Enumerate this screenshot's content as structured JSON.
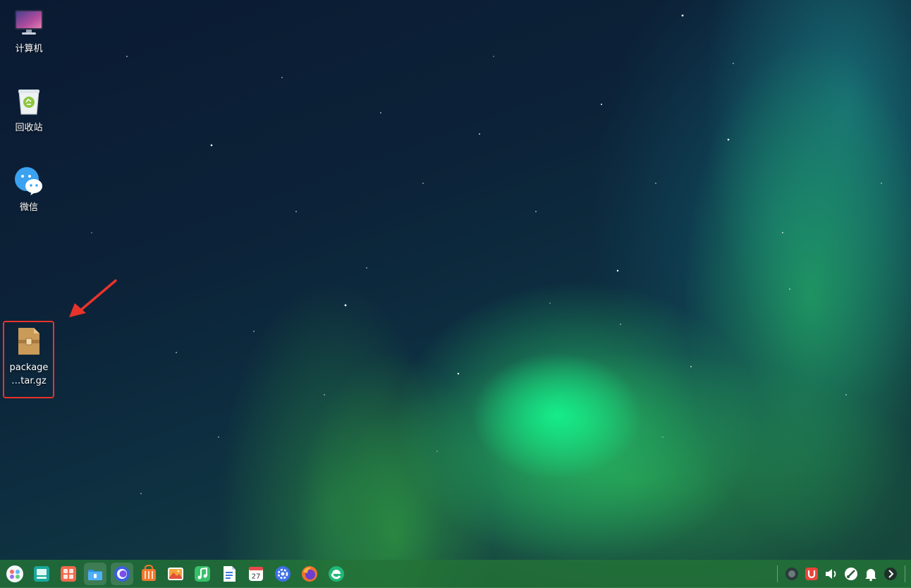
{
  "desktop": {
    "icons": [
      {
        "label": "计算机"
      },
      {
        "label": "回收站"
      },
      {
        "label": "微信"
      },
      {
        "label_line1": "package",
        "label_line2": "…tar.gz"
      }
    ]
  },
  "annotation": {
    "color": "#e8332b"
  },
  "taskbar": {
    "apps": [
      {
        "icon": "launcher-icon"
      },
      {
        "icon": "multitask-view-icon"
      },
      {
        "icon": "workspace-icon"
      },
      {
        "icon": "file-manager-icon"
      },
      {
        "icon": "browser-icon"
      },
      {
        "icon": "app-store-icon"
      },
      {
        "icon": "image-viewer-icon"
      },
      {
        "icon": "music-icon"
      },
      {
        "icon": "document-viewer-icon"
      },
      {
        "icon": "calendar-icon",
        "day": "27"
      },
      {
        "icon": "settings-icon"
      },
      {
        "icon": "firefox-icon"
      },
      {
        "icon": "edge-icon"
      }
    ],
    "tray": [
      {
        "icon": "screen-record-icon"
      },
      {
        "icon": "security-shield-icon"
      },
      {
        "icon": "volume-icon"
      },
      {
        "icon": "network-icon"
      },
      {
        "icon": "notification-bell-icon"
      },
      {
        "icon": "expand-arrow-icon"
      }
    ]
  }
}
